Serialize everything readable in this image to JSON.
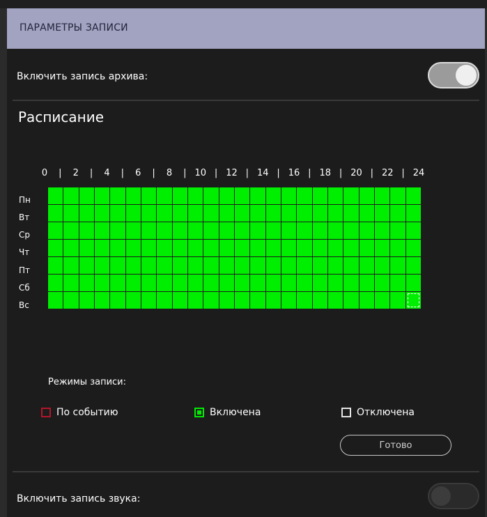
{
  "header": {
    "title": "ПАРАМЕТРЫ ЗАПИСИ"
  },
  "archive": {
    "label": "Включить запись архива:",
    "enabled": true
  },
  "schedule": {
    "title": "Расписание",
    "hour_labels": [
      "0",
      "|",
      "2",
      "|",
      "4",
      "|",
      "6",
      "|",
      "8",
      "|",
      "10",
      "|",
      "12",
      "|",
      "14",
      "|",
      "16",
      "|",
      "18",
      "|",
      "20",
      "|",
      "22",
      "|",
      "24"
    ],
    "days": [
      "Пн",
      "Вт",
      "Ср",
      "Чт",
      "Пт",
      "Сб",
      "Вс"
    ],
    "cell_state": "on",
    "selected_cell": {
      "day": "Вс",
      "hour": 23
    }
  },
  "modes": {
    "label": "Режимы записи:",
    "items": [
      {
        "label": "По событию",
        "kind": "event",
        "color": "#b4152a"
      },
      {
        "label": "Включена",
        "kind": "on",
        "color": "#00ee00"
      },
      {
        "label": "Отключена",
        "kind": "off",
        "color": "#e6e6e6"
      }
    ],
    "done_label": "Готово"
  },
  "sound": {
    "label": "Включить запись звука:",
    "enabled": false
  },
  "colors": {
    "header_bg": "#a2a3c1",
    "cell_on": "#00ee00",
    "panel_bg": "#1c1c1c"
  }
}
